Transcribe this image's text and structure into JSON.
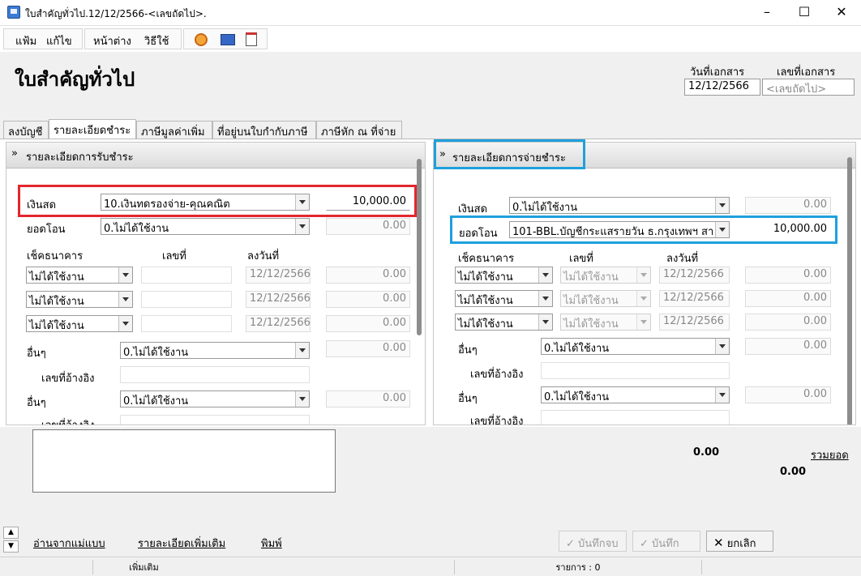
{
  "window": {
    "title": "ใบสำคัญทั่วไป.12/12/2566-<เลขถัดไป>.",
    "controls": [
      "minimize-icon",
      "maximize-icon",
      "close-icon"
    ]
  },
  "menu": {
    "file": "แฟ้ม",
    "edit": "แก้ไข",
    "window": "หน้าต่าง",
    "help": "วิธีใช้"
  },
  "toolbar": {
    "icons": [
      "target-icon",
      "calculator-icon",
      "calendar-icon"
    ]
  },
  "header": {
    "page_title": "ใบสำคัญทั่วไป",
    "doc_date_label": "วันที่เอกสาร",
    "doc_date": "12/12/2566",
    "doc_no_label": "เลขที่เอกสาร",
    "doc_no_placeholder": "<เลขถัดไป>"
  },
  "tabs": [
    {
      "label": "ลงบัญชี"
    },
    {
      "label": "รายละเอียดชำระ"
    },
    {
      "label": "ภาษีมูลค่าเพิ่ม"
    },
    {
      "label": "ที่อยู่บนใบกำกับภาษี"
    },
    {
      "label": "ภาษีหัก ณ ที่จ่าย"
    }
  ],
  "receipt": {
    "title": "รายละเอียดการรับชำระ",
    "cash_label": "เงินสด",
    "cash_account": "10.เงินทดรองจ่าย-คุณคณิต",
    "cash_amount": "10,000.00",
    "transfer_label": "ยอดโอน",
    "transfer_account": "0.ไม่ได้ใช้งาน",
    "transfer_amount": "0.00",
    "cheque_label": "เช็คธนาคาร",
    "no_label": "เลขที่",
    "date_label": "ลงวันที่",
    "cheques": [
      {
        "bank": "ไม่ได้ใช้งาน",
        "date": "12/12/2566",
        "amount": "0.00"
      },
      {
        "bank": "ไม่ได้ใช้งาน",
        "date": "12/12/2566",
        "amount": "0.00"
      },
      {
        "bank": "ไม่ได้ใช้งาน",
        "date": "12/12/2566",
        "amount": "0.00"
      }
    ],
    "other_label": "อื่นๆ",
    "ref_label": "เลขที่อ้างอิง",
    "others": [
      {
        "account": "0.ไม่ได้ใช้งาน",
        "amount": "0.00"
      },
      {
        "account": "0.ไม่ได้ใช้งาน",
        "amount": "0.00"
      }
    ]
  },
  "payment": {
    "title": "รายละเอียดการจ่ายชำระ",
    "cash_label": "เงินสด",
    "cash_account": "0.ไม่ได้ใช้งาน",
    "cash_amount": "0.00",
    "transfer_label": "ยอดโอน",
    "transfer_account": "101-BBL.บัญชีกระแสรายวัน ธ.กรุงเทพฯ สา",
    "transfer_amount": "10,000.00",
    "cheque_label": "เช็คธนาคาร",
    "no_label": "เลขที่",
    "date_label": "ลงวันที่",
    "cheques": [
      {
        "bank": "ไม่ได้ใช้งาน",
        "no": "ไม่ได้ใช้งาน",
        "date": "12/12/2566",
        "amount": "0.00"
      },
      {
        "bank": "ไม่ได้ใช้งาน",
        "no": "ไม่ได้ใช้งาน",
        "date": "12/12/2566",
        "amount": "0.00"
      },
      {
        "bank": "ไม่ได้ใช้งาน",
        "no": "ไม่ได้ใช้งาน",
        "date": "12/12/2566",
        "amount": "0.00"
      }
    ],
    "other_label": "อื่นๆ",
    "ref_label": "เลขที่อ้างอิง",
    "others": [
      {
        "account": "0.ไม่ได้ใช้งาน",
        "amount": "0.00"
      },
      {
        "account": "0.ไม่ได้ใช้งาน",
        "amount": "0.00"
      }
    ]
  },
  "totals": {
    "left_total": "0.00",
    "sum_link": "รวมยอด",
    "sum_total": "0.00"
  },
  "footer": {
    "load_template": "อ่านจากแม่แบบ",
    "more_details": "รายละเอียดเพิ่มเติม",
    "print": "พิมพ์",
    "save_close": "บันทึกจบ",
    "save": "บันทึก",
    "cancel": "ยกเลิก"
  },
  "status": {
    "mode": "เพิ่มเติม",
    "count": "รายการ : 0"
  },
  "colors": {
    "highlight_red": "#e3262d",
    "highlight_blue": "#1ea0dc"
  }
}
